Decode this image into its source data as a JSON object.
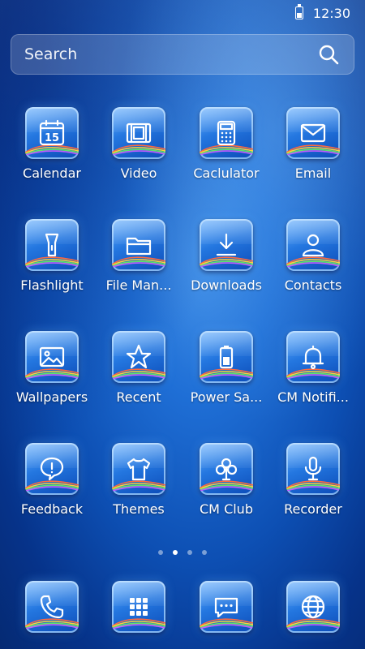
{
  "status_bar": {
    "time": "12:30"
  },
  "search": {
    "placeholder": "Search"
  },
  "apps": [
    {
      "label": "Calendar",
      "icon": "calendar-icon",
      "day": "15"
    },
    {
      "label": "Video",
      "icon": "film-icon"
    },
    {
      "label": "Caclulator",
      "icon": "calculator-icon"
    },
    {
      "label": "Email",
      "icon": "envelope-icon"
    },
    {
      "label": "Flashlight",
      "icon": "flashlight-icon"
    },
    {
      "label": "File Man...",
      "icon": "folder-icon"
    },
    {
      "label": "Downloads",
      "icon": "download-icon"
    },
    {
      "label": "Contacts",
      "icon": "contact-icon"
    },
    {
      "label": "Wallpapers",
      "icon": "image-icon"
    },
    {
      "label": "Recent",
      "icon": "star-icon"
    },
    {
      "label": "Power  Sa...",
      "icon": "battery-icon"
    },
    {
      "label": "CM Notifi...",
      "icon": "bell-icon"
    },
    {
      "label": "Feedback",
      "icon": "feedback-icon"
    },
    {
      "label": "Themes",
      "icon": "tshirt-icon"
    },
    {
      "label": "CM Club",
      "icon": "club-icon"
    },
    {
      "label": "Recorder",
      "icon": "microphone-icon"
    }
  ],
  "pager": {
    "count": 4,
    "active": 1
  },
  "dock": [
    {
      "icon": "phone-icon"
    },
    {
      "icon": "app-drawer-icon"
    },
    {
      "icon": "message-icon"
    },
    {
      "icon": "browser-icon"
    }
  ],
  "colors": {
    "tile_glow": "#aad7ff",
    "background": "#0d4fb3"
  }
}
